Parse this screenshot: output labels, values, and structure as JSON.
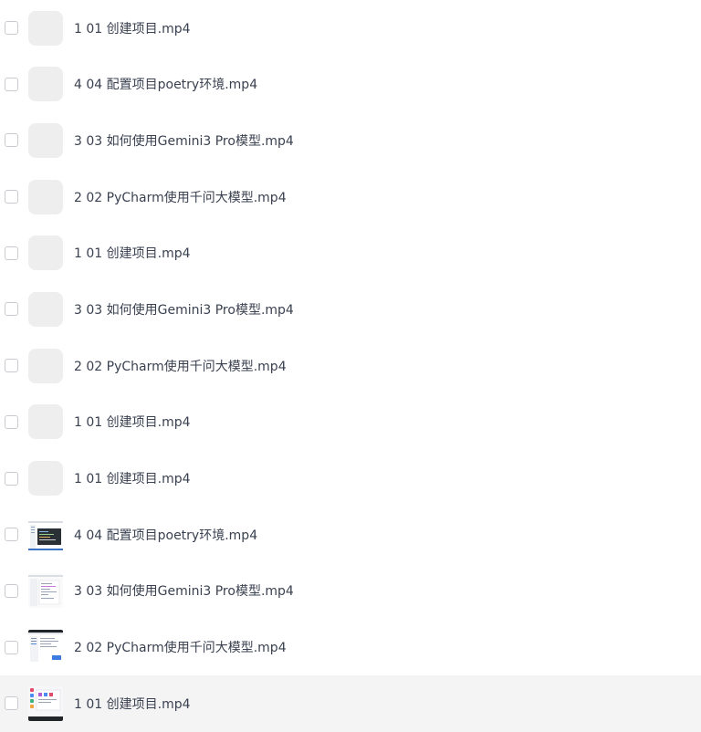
{
  "files": [
    {
      "name": "1 01 创建项目.mp4",
      "thumbnail": "placeholder",
      "selected": false
    },
    {
      "name": "4 04 配置项目poetry环境.mp4",
      "thumbnail": "placeholder",
      "selected": false
    },
    {
      "name": "3 03 如何使用Gemini3 Pro模型.mp4",
      "thumbnail": "placeholder",
      "selected": false
    },
    {
      "name": "2 02 PyCharm使用千问大模型.mp4",
      "thumbnail": "placeholder",
      "selected": false
    },
    {
      "name": "1 01 创建项目.mp4",
      "thumbnail": "placeholder",
      "selected": false
    },
    {
      "name": "3 03 如何使用Gemini3 Pro模型.mp4",
      "thumbnail": "placeholder",
      "selected": false
    },
    {
      "name": "2 02 PyCharm使用千问大模型.mp4",
      "thumbnail": "placeholder",
      "selected": false
    },
    {
      "name": "1 01 创建项目.mp4",
      "thumbnail": "placeholder",
      "selected": false
    },
    {
      "name": "1 01 创建项目.mp4",
      "thumbnail": "placeholder",
      "selected": false
    },
    {
      "name": "4 04 配置项目poetry环境.mp4",
      "thumbnail": "video-dark-editor",
      "selected": false
    },
    {
      "name": "3 03 如何使用Gemini3 Pro模型.mp4",
      "thumbnail": "video-light-doc",
      "selected": false
    },
    {
      "name": "2 02 PyCharm使用千问大模型.mp4",
      "thumbnail": "video-light-ide",
      "selected": false
    },
    {
      "name": "1 01 创建项目.mp4",
      "thumbnail": "video-desktop",
      "selected": false,
      "hovered": true
    }
  ],
  "colors": {
    "row_hover": "#f4f4f5",
    "placeholder_thumb": "#eeeeef",
    "text": "#3a4150",
    "checkbox_border": "#c9cbd0"
  }
}
